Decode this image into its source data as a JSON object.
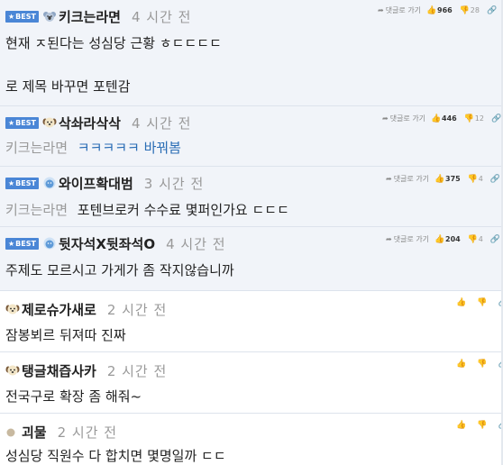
{
  "ui": {
    "best_label": "BEST",
    "reply_label": "댓글로 가기"
  },
  "comments": [
    {
      "best": true,
      "nickname": "키크는라면",
      "time": "4 시간 전",
      "likes": "966",
      "dislikes": "28",
      "lines": [
        "현재 ㅈ된다는 성심당 근황 ㅎㄷㄷㄷㄷ",
        "",
        "로 제목 바꾸면 포텐감"
      ]
    },
    {
      "best": true,
      "nickname": "삭솨라삭삭",
      "time": "4 시간 전",
      "likes": "446",
      "dislikes": "12",
      "quote": "키크는라면",
      "text": "ㅋㅋㅋㅋㅋ 바꿔봄"
    },
    {
      "best": true,
      "nickname": "와이프확대범",
      "time": "3 시간 전",
      "likes": "375",
      "dislikes": "4",
      "quote": "키크는라면",
      "text": "포텐브로커 수수료 몇퍼인가요 ㄷㄷㄷ"
    },
    {
      "best": true,
      "nickname": "뒷자석X뒷좌석O",
      "time": "4 시간 전",
      "likes": "204",
      "dislikes": "4",
      "text": "주제도 모르시고 가게가 좀 작지않습니까"
    },
    {
      "best": false,
      "nickname": "제로슈가새로",
      "time": "2 시간 전",
      "text": "잠봉뵈르 뒤져따 진짜"
    },
    {
      "best": false,
      "nickname": "탱글채즙사카",
      "time": "2 시간 전",
      "text": "전국구로 확장 좀 해줘~"
    },
    {
      "best": false,
      "nickname": "괴물",
      "time": "2 시간 전",
      "text": "성심당 직원수 다 합치면 몇명일까 ㄷㄷ"
    }
  ],
  "colors": {
    "best_bg": "#f1f4f9",
    "badge": "#4a86d6",
    "link": "#2a6db5",
    "muted": "#999999"
  },
  "icons": {
    "reply": "reply-arrow-icon",
    "like": "thumbs-up-icon",
    "dislike": "thumbs-down-icon",
    "share": "link-icon",
    "avatar": "dog-avatar-icon",
    "level": "circle-level-icon"
  }
}
